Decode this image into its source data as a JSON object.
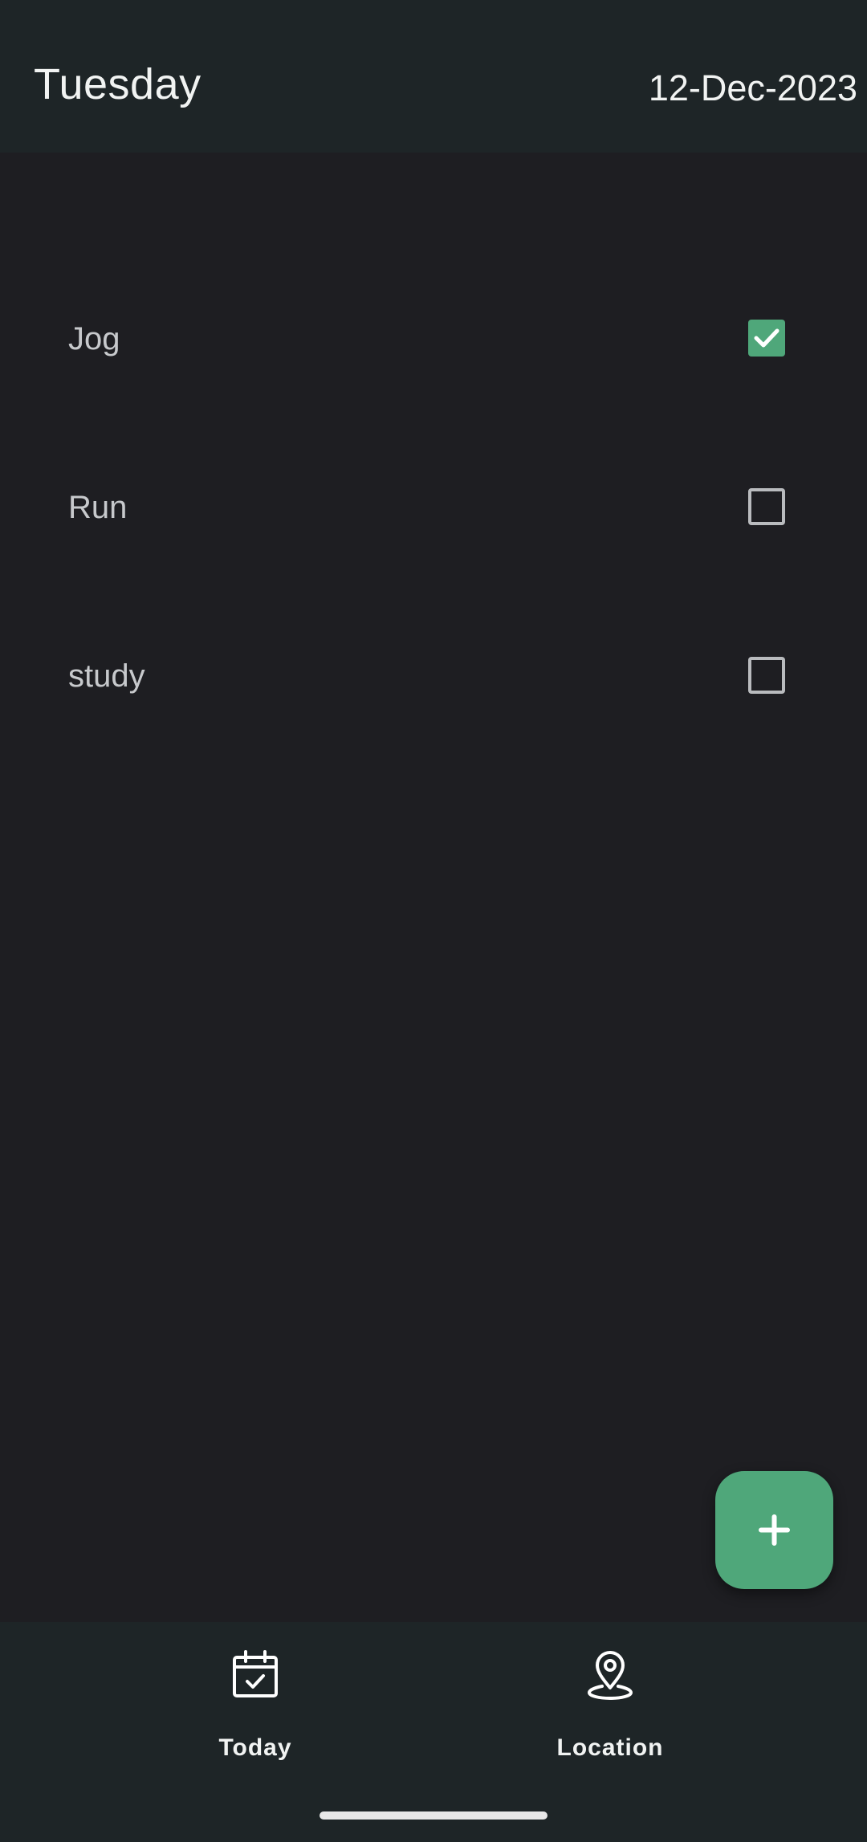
{
  "header": {
    "day": "Tuesday",
    "date": "12-Dec-2023"
  },
  "tasks": [
    {
      "label": "Jog",
      "checked": true
    },
    {
      "label": "Run",
      "checked": false
    },
    {
      "label": "study",
      "checked": false
    }
  ],
  "fab": {
    "icon": "plus-icon"
  },
  "bottom_nav": {
    "items": [
      {
        "label": "Today",
        "icon": "calendar-check-icon"
      },
      {
        "label": "Location",
        "icon": "map-pin-icon"
      }
    ]
  },
  "colors": {
    "accent": "#4fa77a",
    "background": "#1e1e22",
    "bar": "#1e2527",
    "text": "#f1f3f2"
  }
}
